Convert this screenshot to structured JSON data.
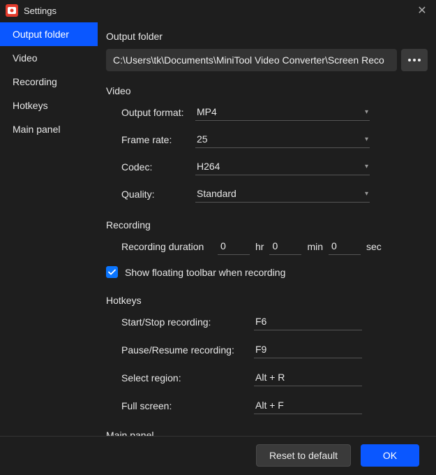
{
  "window": {
    "title": "Settings"
  },
  "sidebar": {
    "items": [
      {
        "label": "Output folder",
        "active": true
      },
      {
        "label": "Video",
        "active": false
      },
      {
        "label": "Recording",
        "active": false
      },
      {
        "label": "Hotkeys",
        "active": false
      },
      {
        "label": "Main panel",
        "active": false
      }
    ]
  },
  "sections": {
    "output_folder": {
      "heading": "Output folder",
      "path": "C:\\Users\\tk\\Documents\\MiniTool Video Converter\\Screen Reco"
    },
    "video": {
      "heading": "Video",
      "fields": {
        "output_format": {
          "label": "Output format:",
          "value": "MP4"
        },
        "frame_rate": {
          "label": "Frame rate:",
          "value": "25"
        },
        "codec": {
          "label": "Codec:",
          "value": "H264"
        },
        "quality": {
          "label": "Quality:",
          "value": "Standard"
        }
      }
    },
    "recording": {
      "heading": "Recording",
      "duration_label": "Recording duration",
      "hr_value": "0",
      "hr_unit": "hr",
      "min_value": "0",
      "min_unit": "min",
      "sec_value": "0",
      "sec_unit": "sec",
      "show_toolbar_label": "Show floating toolbar when recording"
    },
    "hotkeys": {
      "heading": "Hotkeys",
      "fields": {
        "start_stop": {
          "label": "Start/Stop recording:",
          "value": "F6"
        },
        "pause_resume": {
          "label": "Pause/Resume recording:",
          "value": "F9"
        },
        "select_region": {
          "label": "Select region:",
          "value": "Alt + R"
        },
        "full_screen": {
          "label": "Full screen:",
          "value": "Alt + F"
        }
      }
    },
    "main_panel": {
      "heading": "Main panel"
    }
  },
  "footer": {
    "reset_label": "Reset to default",
    "ok_label": "OK"
  }
}
